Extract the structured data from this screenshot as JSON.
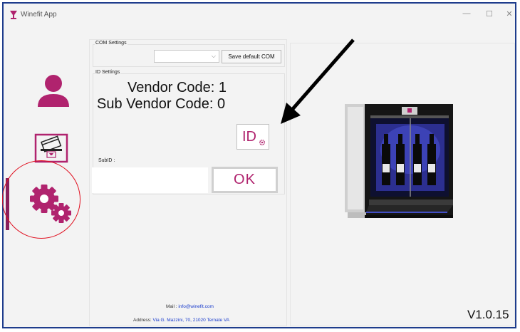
{
  "window": {
    "title": "Winefit App",
    "controls": [
      "—",
      "☐",
      "✕"
    ]
  },
  "colors": {
    "accent": "#b0236e",
    "annotation": "#e01020",
    "link": "#1a3ccc"
  },
  "sidebar": {
    "items": [
      {
        "name": "user",
        "icon": "user-icon"
      },
      {
        "name": "card",
        "icon": "card-reader-icon"
      },
      {
        "name": "settings",
        "icon": "gears-icon",
        "active": true
      }
    ]
  },
  "com_settings": {
    "label": "COM Settings",
    "selected_port": "",
    "save_label": "Save default COM"
  },
  "id_settings": {
    "label": "ID Settings",
    "vendor_code_text": "Vendor Code:  1",
    "sub_vendor_code_text": "Sub Vendor Code:  0",
    "id_button_label": "ID",
    "subid_label": "SubID :",
    "subid_value": "",
    "ok_label": "OK"
  },
  "footer": {
    "mail_label": "Mail :",
    "mail_value": "info@winefit.com",
    "address_label": "Address:",
    "address_value": "Via G. Mazzini, 70, 21020 Ternate VA"
  },
  "version": "V1.0.15"
}
